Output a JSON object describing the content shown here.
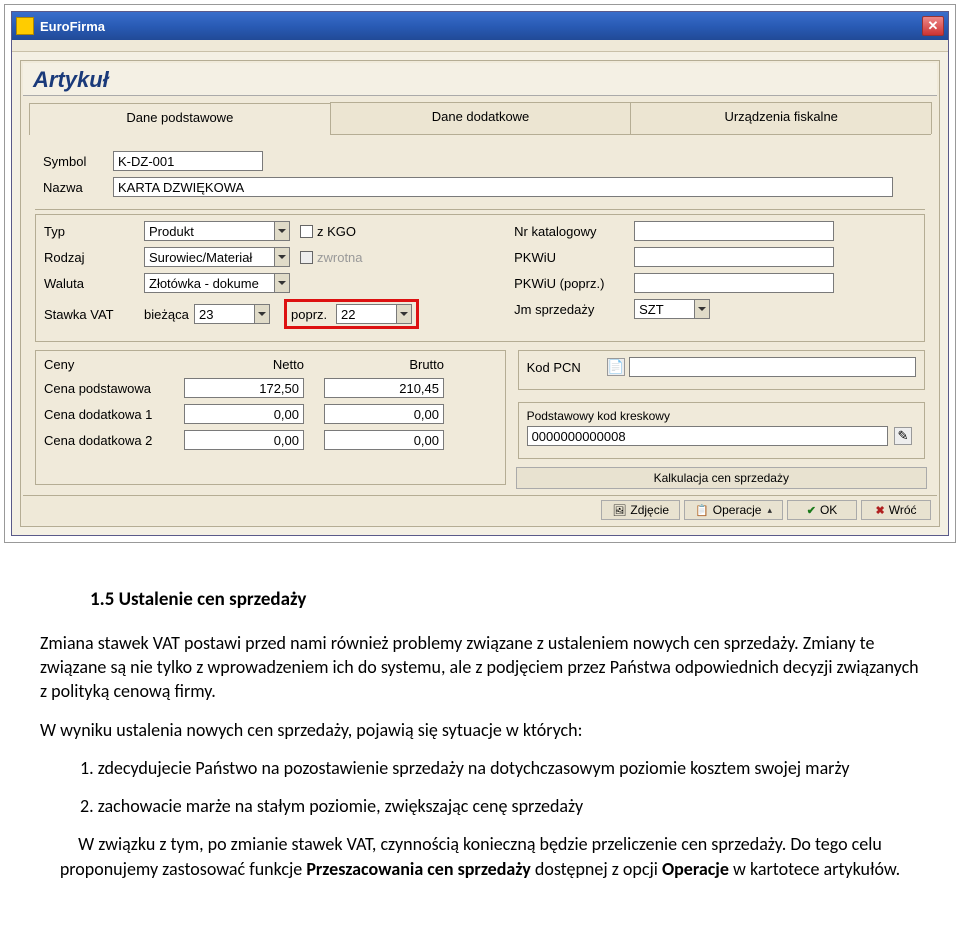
{
  "window": {
    "title": "EuroFirma"
  },
  "panel": {
    "title": "Artykuł"
  },
  "tabs": {
    "t0": "Dane podstawowe",
    "t1": "Dane dodatkowe",
    "t2": "Urządzenia fiskalne"
  },
  "fields": {
    "symbol_label": "Symbol",
    "symbol_value": "K-DZ-001",
    "nazwa_label": "Nazwa",
    "nazwa_value": "KARTA DZWIĘKOWA",
    "typ_label": "Typ",
    "typ_value": "Produkt",
    "zkgo_label": "z KGO",
    "rodzaj_label": "Rodzaj",
    "rodzaj_value": "Surowiec/Materiał",
    "zwrotna_label": "zwrotna",
    "waluta_label": "Waluta",
    "waluta_value": "Złotówka - dokume",
    "stawka_label": "Stawka VAT",
    "biezaca_label": "bieżąca",
    "biezaca_value": "23",
    "poprz_label": "poprz.",
    "poprz_value": "22",
    "nrkat_label": "Nr katalogowy",
    "nrkat_value": "",
    "pkwiu_label": "PKWiU",
    "pkwiu_value": "",
    "pkwiup_label": "PKWiU (poprz.)",
    "pkwiup_value": "",
    "jm_label": "Jm sprzedaży",
    "jm_value": "SZT",
    "ceny_header": "Ceny",
    "netto_header": "Netto",
    "brutto_header": "Brutto",
    "cena_podst_label": "Cena podstawowa",
    "cena_podst_netto": "172,50",
    "cena_podst_brutto": "210,45",
    "cena_dod1_label": "Cena dodatkowa 1",
    "cena_dod1_netto": "0,00",
    "cena_dod1_brutto": "0,00",
    "cena_dod2_label": "Cena dodatkowa 2",
    "cena_dod2_netto": "0,00",
    "cena_dod2_brutto": "0,00",
    "kodpcn_label": "Kod PCN",
    "kodpcn_value": "",
    "kodkresk_label": "Podstawowy kod kreskowy",
    "kodkresk_value": "0000000000008",
    "kalkulacja_btn": "Kalkulacja cen sprzedaży"
  },
  "buttons": {
    "zdjecie": "Zdjęcie",
    "operacje": "Operacje",
    "ok": "OK",
    "wroc": "Wróć"
  },
  "doc": {
    "h": "1.5 Ustalenie cen sprzedaży",
    "p1": "Zmiana stawek VAT postawi przed nami również problemy związane z ustaleniem nowych cen sprzedaży. Zmiany te związane są nie tylko z wprowadzeniem ich do systemu, ale z podjęciem przez Państwa odpowiednich decyzji związanych z polityką cenową firmy.",
    "p2": "W wyniku ustalenia nowych cen sprzedaży, pojawią się sytuacje w których:",
    "li1": "1. zdecydujecie Państwo na pozostawienie sprzedaży na dotychczasowym poziomie kosztem swojej marży",
    "li2": "2. zachowacie marże na stałym poziomie, zwiększając cenę sprzedaży",
    "p3a": "W związku z tym, po zmianie stawek VAT, czynnością konieczną będzie przeliczenie cen sprzedaży. Do tego celu proponujemy zastosować funkcje ",
    "p3b": "Przeszacowania cen sprzedaży",
    "p3c": " dostępnej z opcji ",
    "p3d": "Operacje",
    "p3e": " w kartotece artykułów."
  }
}
